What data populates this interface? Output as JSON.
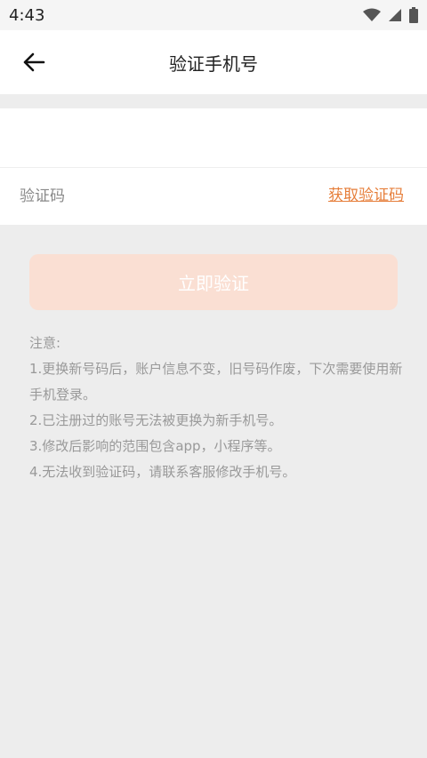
{
  "status_bar": {
    "time": "4:43"
  },
  "header": {
    "title": "验证手机号"
  },
  "form": {
    "phone_value": "",
    "code_placeholder": "验证码",
    "get_code_label": "获取验证码"
  },
  "verify_button": {
    "label": "立即验证"
  },
  "notes": {
    "title": "注意:",
    "items": [
      "1.更换新号码后，账户信息不变，旧号码作废，下次需要使用新手机登录。",
      "2.已注册过的账号无法被更换为新手机号。",
      "3.修改后影响的范围包含app，小程序等。",
      "4.无法收到验证码，请联系客服修改手机号。"
    ]
  },
  "colors": {
    "accent": "#e67e3a",
    "button_disabled": "#fadfd3",
    "background": "#ededed"
  }
}
